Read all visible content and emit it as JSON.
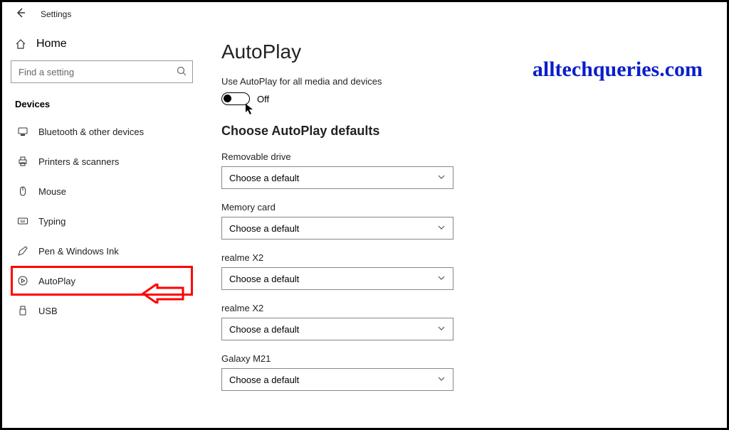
{
  "app_title": "Settings",
  "watermark": "alltechqueries.com",
  "sidebar": {
    "home_label": "Home",
    "search_placeholder": "Find a setting",
    "category": "Devices",
    "items": [
      {
        "label": "Bluetooth & other devices"
      },
      {
        "label": "Printers & scanners"
      },
      {
        "label": "Mouse"
      },
      {
        "label": "Typing"
      },
      {
        "label": "Pen & Windows Ink"
      },
      {
        "label": "AutoPlay"
      },
      {
        "label": "USB"
      }
    ]
  },
  "main": {
    "title": "AutoPlay",
    "toggle_label": "Use AutoPlay for all media and devices",
    "toggle_state": "Off",
    "section_title": "Choose AutoPlay defaults",
    "defaults_text": "Choose a default",
    "devices": [
      {
        "name": "Removable drive"
      },
      {
        "name": "Memory card"
      },
      {
        "name": "realme X2"
      },
      {
        "name": "realme X2"
      },
      {
        "name": "Galaxy M21"
      }
    ]
  }
}
